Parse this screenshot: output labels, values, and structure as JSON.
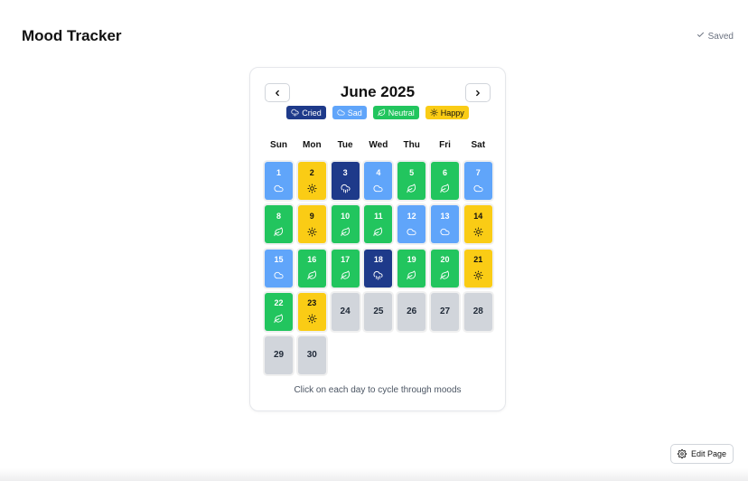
{
  "header": {
    "title": "Mood Tracker",
    "saved_label": "Saved"
  },
  "calendar": {
    "month_title": "June 2025",
    "prev_icon": "chevron-left-icon",
    "next_icon": "chevron-right-icon",
    "legend": [
      {
        "mood": "cried",
        "label": "Cried",
        "color": "#1e3a8a",
        "text_color": "#ffffff",
        "icon": "cloud-rain-icon"
      },
      {
        "mood": "sad",
        "label": "Sad",
        "color": "#60a5fa",
        "text_color": "#ffffff",
        "icon": "cloud-icon"
      },
      {
        "mood": "neutral",
        "label": "Neutral",
        "color": "#22c55e",
        "text_color": "#ffffff",
        "icon": "leaf-icon"
      },
      {
        "mood": "happy",
        "label": "Happy",
        "color": "#facc15",
        "text_color": "#111111",
        "icon": "sun-icon"
      }
    ],
    "empty_color": "#d1d5db",
    "weekdays": [
      "Sun",
      "Mon",
      "Tue",
      "Wed",
      "Thu",
      "Fri",
      "Sat"
    ],
    "first_weekday_index": 0,
    "days": [
      {
        "day": "1",
        "mood": "sad"
      },
      {
        "day": "2",
        "mood": "happy"
      },
      {
        "day": "3",
        "mood": "cried"
      },
      {
        "day": "4",
        "mood": "sad"
      },
      {
        "day": "5",
        "mood": "neutral"
      },
      {
        "day": "6",
        "mood": "neutral"
      },
      {
        "day": "7",
        "mood": "sad"
      },
      {
        "day": "8",
        "mood": "neutral"
      },
      {
        "day": "9",
        "mood": "happy"
      },
      {
        "day": "10",
        "mood": "neutral"
      },
      {
        "day": "11",
        "mood": "neutral"
      },
      {
        "day": "12",
        "mood": "sad"
      },
      {
        "day": "13",
        "mood": "sad"
      },
      {
        "day": "14",
        "mood": "happy"
      },
      {
        "day": "15",
        "mood": "sad"
      },
      {
        "day": "16",
        "mood": "neutral"
      },
      {
        "day": "17",
        "mood": "neutral"
      },
      {
        "day": "18",
        "mood": "cried"
      },
      {
        "day": "19",
        "mood": "neutral"
      },
      {
        "day": "20",
        "mood": "neutral"
      },
      {
        "day": "21",
        "mood": "happy"
      },
      {
        "day": "22",
        "mood": "neutral"
      },
      {
        "day": "23",
        "mood": "happy"
      },
      {
        "day": "24",
        "mood": ""
      },
      {
        "day": "25",
        "mood": ""
      },
      {
        "day": "26",
        "mood": ""
      },
      {
        "day": "27",
        "mood": ""
      },
      {
        "day": "28",
        "mood": ""
      },
      {
        "day": "29",
        "mood": ""
      },
      {
        "day": "30",
        "mood": ""
      }
    ],
    "hint": "Click on each day to cycle through moods"
  },
  "footer": {
    "edit_label": "Edit Page",
    "edit_icon": "gear-icon"
  }
}
